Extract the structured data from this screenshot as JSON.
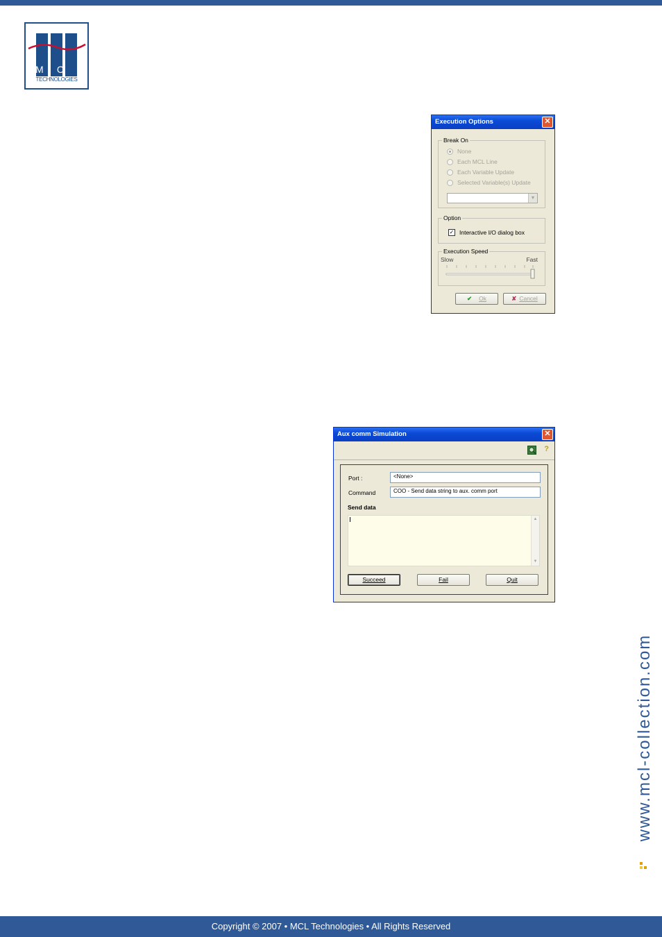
{
  "logo": {
    "letters": [
      "M",
      "C",
      "L"
    ],
    "tagline": "TECHNOLOGIES"
  },
  "colors": {
    "brand": "#2f5a97",
    "xp_title": "#0a4bd6",
    "dialog_face": "#ece9d8"
  },
  "execution_options": {
    "title": "Execution Options",
    "break_on": {
      "legend": "Break On",
      "options": [
        "None",
        "Each MCL Line",
        "Each Variable Update",
        "Selected Variable(s) Update"
      ],
      "selected": "None"
    },
    "option": {
      "legend": "Option",
      "checkbox_label": "Interactive I/O dialog box",
      "checked": true
    },
    "speed": {
      "legend": "Execution Speed",
      "slow_label": "Slow",
      "fast_label": "Fast",
      "value": 1.0
    },
    "ok_label": "Ok",
    "cancel_label": "Cancel"
  },
  "aux_comm": {
    "title": "Aux comm Simulation",
    "port_label": "Port :",
    "port_value": "<None>",
    "command_label": "Command",
    "command_value": "COO - Send data string to aux. comm port",
    "send_data_label": "Send data",
    "send_data_value": "",
    "succeed_label": "Succeed",
    "fail_label": "Fail",
    "quit_label": "Quit"
  },
  "sidebar": {
    "url": "www.mcl-collection.com"
  },
  "footer": {
    "copyright": "Copyright © 2007 • MCL Technologies • All Rights Reserved"
  }
}
